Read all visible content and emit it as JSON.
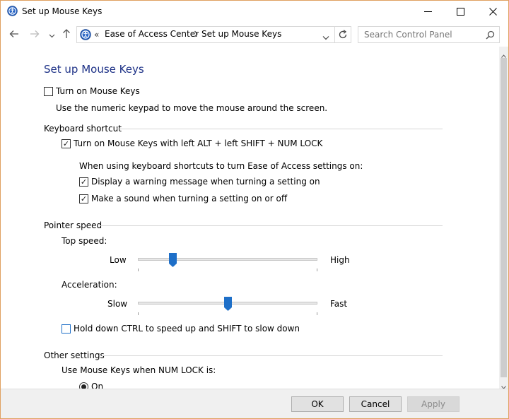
{
  "window": {
    "title": "Set up Mouse Keys"
  },
  "address": {
    "separator": "«",
    "crumbs": [
      "Ease of Access Center",
      "Set up Mouse Keys"
    ]
  },
  "search": {
    "placeholder": "Search Control Panel"
  },
  "page": {
    "heading": "Set up Mouse Keys",
    "turn_on": {
      "label": "Turn on Mouse Keys",
      "checked": false
    },
    "turn_on_desc": "Use the numeric keypad to move the mouse around the screen.",
    "keyboard_shortcut": {
      "title": "Keyboard shortcut",
      "shortcut_option": {
        "label": "Turn on Mouse Keys with left ALT + left SHIFT + NUM LOCK",
        "checked": true
      },
      "sub_heading": "When using keyboard shortcuts to turn Ease of Access settings on:",
      "warning_option": {
        "label": "Display a warning message when turning a setting on",
        "checked": true
      },
      "sound_option": {
        "label": "Make a sound when turning a setting on or off",
        "checked": true
      }
    },
    "pointer_speed": {
      "title": "Pointer speed",
      "top_speed": {
        "label": "Top speed:",
        "min_label": "Low",
        "max_label": "High",
        "value": 0.18
      },
      "acceleration": {
        "label": "Acceleration:",
        "min_label": "Slow",
        "max_label": "Fast",
        "value": 0.5
      },
      "ctrl_shift_option": {
        "label": "Hold down CTRL to speed up and SHIFT to slow down",
        "checked": false
      }
    },
    "other_settings": {
      "title": "Other settings",
      "numlock_label": "Use Mouse Keys when NUM LOCK is:",
      "on_option": {
        "label": "On",
        "selected": true
      }
    }
  },
  "footer": {
    "ok": "OK",
    "cancel": "Cancel",
    "apply": "Apply"
  },
  "colors": {
    "accent": "#1e6fc8",
    "heading": "#1e3287"
  },
  "icons": {
    "app": "ease-of-access-icon",
    "back": "arrow-left-icon",
    "forward": "arrow-right-icon",
    "recent": "chevron-down-icon",
    "up": "arrow-up-icon",
    "search": "search-icon",
    "refresh": "refresh-icon"
  }
}
